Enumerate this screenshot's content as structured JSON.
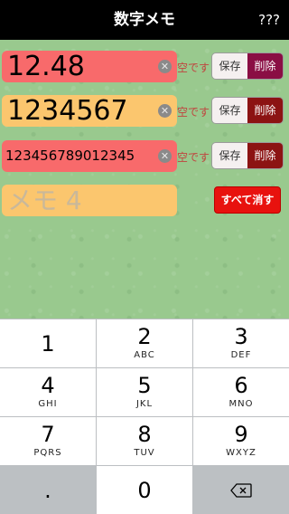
{
  "header": {
    "title": "数字メモ",
    "help_label": "???"
  },
  "memos": [
    {
      "value": "12.48",
      "placeholder": "",
      "bg_color": "#f86a6b",
      "delete_color": "#8a0e44"
    },
    {
      "value": "1234567",
      "placeholder": "",
      "bg_color": "#fbc66e",
      "delete_color": "#8c1313"
    },
    {
      "value": "123456789012345",
      "placeholder": "",
      "bg_color": "#f86a6b",
      "delete_color": "#8c1313"
    },
    {
      "value": "",
      "placeholder": "メモ 4",
      "bg_color": "#fbc66e"
    }
  ],
  "empty_label": "空です",
  "save_label": "保存",
  "delete_label": "削除",
  "clear_all_label": "すべて消す",
  "keyboard": {
    "keys": [
      {
        "digit": "1",
        "letters": ""
      },
      {
        "digit": "2",
        "letters": "ABC"
      },
      {
        "digit": "3",
        "letters": "DEF"
      },
      {
        "digit": "4",
        "letters": "GHI"
      },
      {
        "digit": "5",
        "letters": "JKL"
      },
      {
        "digit": "6",
        "letters": "MNO"
      },
      {
        "digit": "7",
        "letters": "PQRS"
      },
      {
        "digit": "8",
        "letters": "TUV"
      },
      {
        "digit": "9",
        "letters": "WXYZ"
      }
    ],
    "dot_label": ".",
    "zero_label": "0",
    "backspace_icon": "backspace-icon"
  }
}
